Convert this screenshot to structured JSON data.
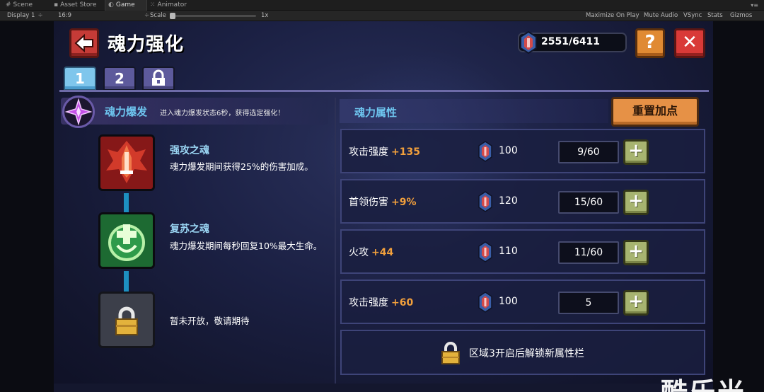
{
  "editor": {
    "tabs": [
      {
        "label": "Scene",
        "icon": "grid-icon"
      },
      {
        "label": "Asset Store",
        "icon": "bag-icon"
      },
      {
        "label": "Game",
        "icon": "gamepad-icon"
      },
      {
        "label": "Animator",
        "icon": "animator-icon"
      }
    ],
    "toolbar": {
      "display": "Display 1",
      "aspect": "16:9",
      "scale_label": "Scale",
      "scale_value": "1x",
      "maximize": "Maximize On Play",
      "mute": "Mute Audio",
      "vsync": "VSync",
      "stats": "Stats",
      "gizmos": "Gizmos"
    }
  },
  "game": {
    "title": "魂力强化",
    "currency": "2551/6411",
    "help_label": "?",
    "close_label": "✕",
    "tabs": [
      "1",
      "2"
    ],
    "burst": {
      "name": "魂力爆发",
      "desc": "进入魂力爆发状态6秒，获得选定强化！"
    },
    "skills": [
      {
        "name": "强攻之魂",
        "desc": "魂力爆发期间获得25%的伤害加成。"
      },
      {
        "name": "复苏之魂",
        "desc": "魂力爆发期间每秒回复10%最大生命。"
      },
      {
        "name": "",
        "desc": "暂未开放，敬请期待"
      }
    ],
    "attributes": {
      "title": "魂力属性",
      "reset_label": "重置加点",
      "rows": [
        {
          "label": "攻击强度",
          "bonus": "+135",
          "cost": "100",
          "level": "9/60"
        },
        {
          "label": "首领伤害",
          "bonus": "+9%",
          "cost": "120",
          "level": "15/60"
        },
        {
          "label": "火攻",
          "bonus": "+44",
          "cost": "110",
          "level": "11/60"
        },
        {
          "label": "攻击强度",
          "bonus": "+60",
          "cost": "100",
          "level": "5"
        }
      ],
      "plus_label": "+",
      "locked_text": "区域3开启后解锁新属性栏"
    }
  },
  "watermark": "酷乐米",
  "colors": {
    "accent_blue": "#6ec6f0",
    "bonus_orange": "#f2a03c",
    "panel_bg": "#1b2043",
    "red_button": "#d93a38",
    "orange_button": "#e08a33"
  }
}
